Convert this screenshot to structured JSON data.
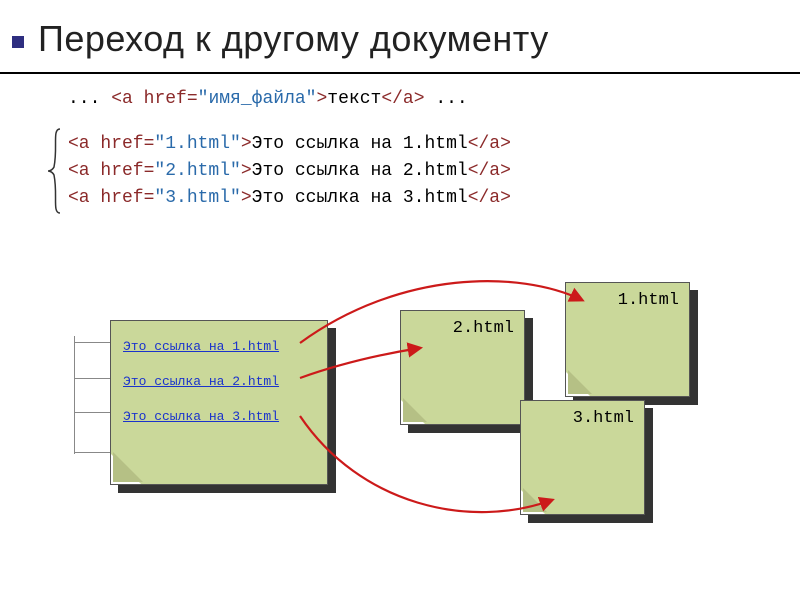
{
  "title": "Переход к другому документу",
  "syntax": {
    "prefix": "... ",
    "lt1": "<",
    "tag_a": "a ",
    "attr_href": "href=",
    "val_filename": "\"имя_файла\"",
    "gt1": ">",
    "text": "текст",
    "close": "</a>",
    "suffix": " ..."
  },
  "examples": [
    {
      "val": "\"1.html\"",
      "text": "Это ссылка на 1.html"
    },
    {
      "val": "\"2.html\"",
      "text": "Это ссылка на 2.html"
    },
    {
      "val": "\"3.html\"",
      "text": "Это ссылка на 3.html"
    }
  ],
  "source_links": [
    "Это ссылка на 1.html",
    "Это ссылка на 2.html",
    "Это ссылка на 3.html"
  ],
  "targets": {
    "t1": "1.html",
    "t2": "2.html",
    "t3": "3.html"
  }
}
